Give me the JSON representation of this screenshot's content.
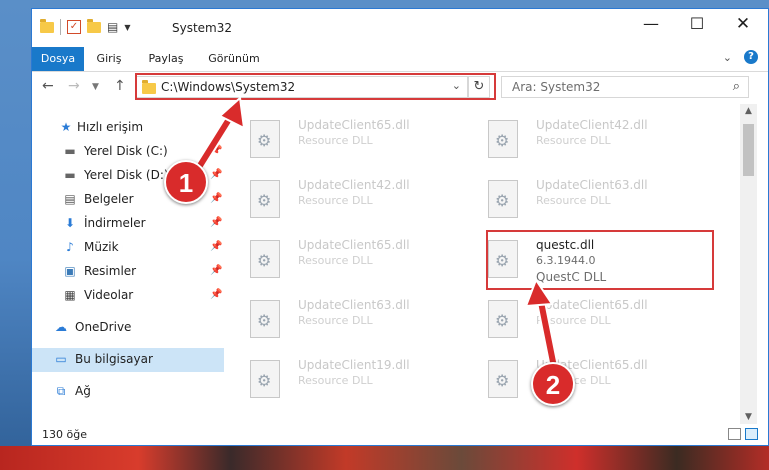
{
  "window": {
    "title": "System32",
    "controls": {
      "minimize": "—",
      "maximize": "☐",
      "close": "✕"
    }
  },
  "ribbon": {
    "tabs": [
      "Dosya",
      "Giriş",
      "Paylaş",
      "Görünüm"
    ],
    "help": "?"
  },
  "navigation": {
    "address": "C:\\Windows\\System32",
    "search_placeholder": "Ara: System32"
  },
  "sidebar": {
    "items": [
      {
        "label": "Hızlı erişim",
        "icon": "star-icon"
      },
      {
        "label": "Yerel Disk (C:)",
        "icon": "drive-icon",
        "pinned": true
      },
      {
        "label": "Yerel Disk (D:)",
        "icon": "drive-icon",
        "pinned": true
      },
      {
        "label": "Belgeler",
        "icon": "document-icon",
        "pinned": true
      },
      {
        "label": "İndirmeler",
        "icon": "download-icon",
        "pinned": true
      },
      {
        "label": "Müzik",
        "icon": "music-icon",
        "pinned": true
      },
      {
        "label": "Resimler",
        "icon": "pictures-icon",
        "pinned": true
      },
      {
        "label": "Videolar",
        "icon": "video-icon",
        "pinned": true
      },
      {
        "label": "OneDrive",
        "icon": "cloud-icon"
      },
      {
        "label": "Bu bilgisayar",
        "icon": "computer-icon",
        "selected": true
      },
      {
        "label": "Ağ",
        "icon": "network-icon"
      }
    ]
  },
  "files": {
    "left": [
      {
        "name": "UpdateClient65.dll",
        "desc": "Resource DLL"
      },
      {
        "name": "UpdateClient42.dll",
        "desc": "Resource DLL"
      },
      {
        "name": "UpdateClient65.dll",
        "desc": "Resource DLL"
      },
      {
        "name": "UpdateClient63.dll",
        "desc": "Resource DLL"
      },
      {
        "name": "UpdateClient19.dll",
        "desc": "Resource DLL"
      }
    ],
    "right": [
      {
        "name": "UpdateClient42.dll",
        "desc": "Resource DLL"
      },
      {
        "name": "UpdateClient63.dll",
        "desc": "Resource DLL"
      },
      {
        "name": "questc.dll",
        "version": "6.3.1944.0",
        "desc": "QuestC DLL",
        "highlighted": true
      },
      {
        "name": "UpdateClient65.dll",
        "desc": "Resource DLL"
      },
      {
        "name": "UpdateClient65.dll",
        "desc": "Resource DLL"
      }
    ]
  },
  "status": {
    "item_count": "130 öğe"
  },
  "annotations": {
    "step1": "1",
    "step2": "2",
    "color": "#d63a3a"
  }
}
